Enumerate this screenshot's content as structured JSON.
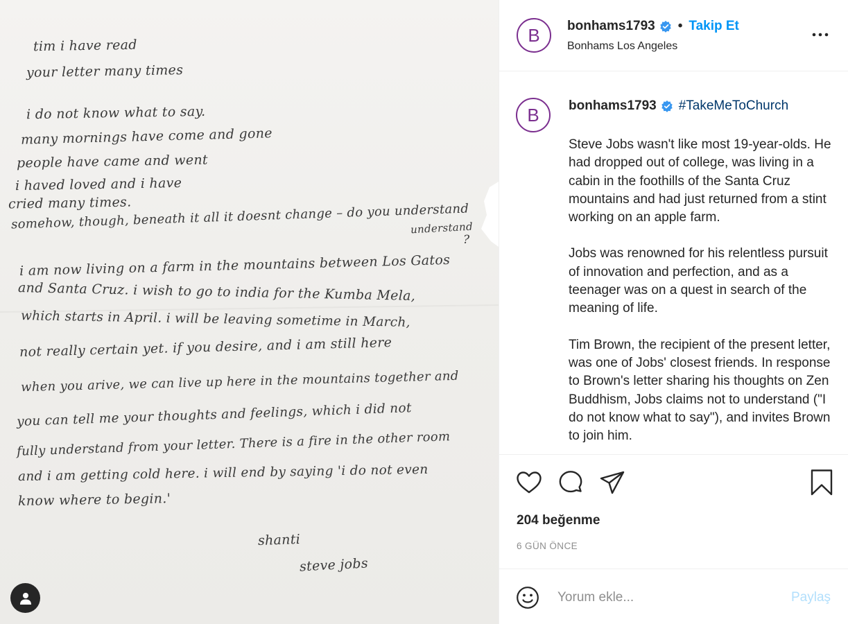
{
  "letter": {
    "lines": [
      "tim          i have read",
      "your letter many times",
      "i do not know what to say.",
      "many mornings have come and gone",
      "people have came and went",
      "i haved loved and i have",
      "cried many times.",
      "somehow, though, beneath it all it doesnt change – do you understand",
      "understand",
      "?",
      "i am now living on a farm in the mountains between Los Gatos",
      "and Santa Cruz. i wish to go to india for the Kumba Mela,",
      "which starts in April. i will be leaving sometime in March,",
      "not really certain yet. if you desire, and i am still here",
      "when you arive, we can live up here in the mountains together and",
      "you can tell me your thoughts and feelings, which i did not",
      "fully understand from your letter. There is a fire in the other room",
      "and i am getting cold here. i will end by saying 'i do not even",
      "know where to begin.'",
      "shanti",
      "steve jobs"
    ]
  },
  "header": {
    "avatar_letter": "B",
    "username": "bonhams1793",
    "separator": "•",
    "follow_label": "Takip Et",
    "location": "Bonhams Los Angeles",
    "more_label": "..."
  },
  "caption": {
    "avatar_letter": "B",
    "username": "bonhams1793",
    "hashtag": "#TakeMeToChurch",
    "paragraphs": [
      "Steve Jobs wasn't like most 19-year-olds. He had dropped out of college, was living in a cabin in the foothills of the Santa Cruz mountains and had just returned from a stint working on an apple farm.",
      "Jobs was renowned for his relentless pursuit of innovation and perfection, and as a teenager was on a quest in search of the meaning of life.",
      "Tim Brown, the recipient of the present letter, was one of Jobs' closest friends. In response to Brown's letter sharing his thoughts on Zen Buddhism, Jobs claims not to understand (\"I do not know what to say\"), and invites Brown to join him."
    ]
  },
  "actions": {
    "likes": "204 beğenme",
    "time": "6 GÜN ÖNCE"
  },
  "comment": {
    "placeholder": "Yorum ekle...",
    "post_label": "Paylaş"
  },
  "colors": {
    "link_blue": "#0095f6",
    "avatar_purple": "#7b2f8f",
    "muted_gray": "#8e8e8e",
    "disabled_blue": "#b2dffc"
  }
}
